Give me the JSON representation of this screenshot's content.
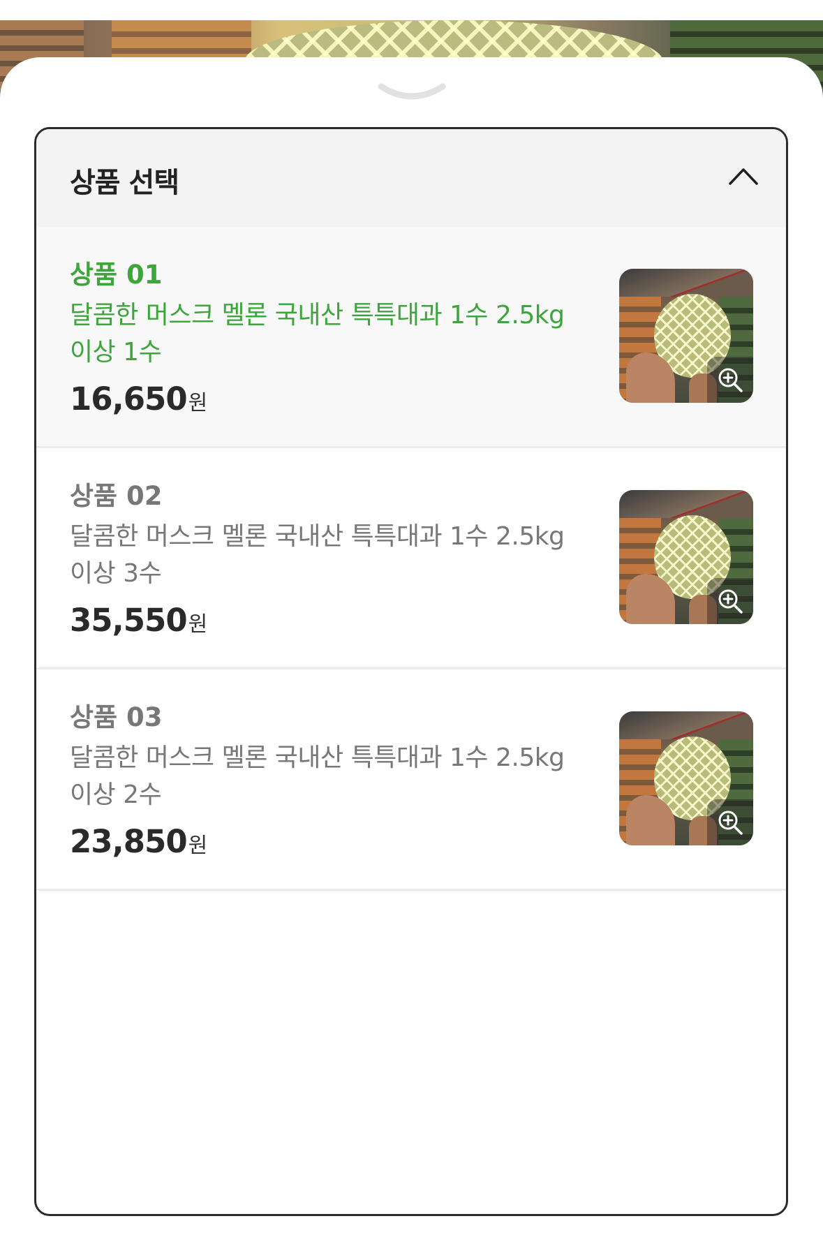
{
  "section": {
    "title": "상품 선택"
  },
  "products": [
    {
      "label": "상품 01",
      "name": "달콤한 머스크 멜론 국내산 특특대과 1수 2.5kg 이상 1수",
      "price": "16,650",
      "currency": "원",
      "selected": true
    },
    {
      "label": "상품 02",
      "name": "달콤한 머스크 멜론 국내산 특특대과 1수 2.5kg 이상 3수",
      "price": "35,550",
      "currency": "원",
      "selected": false
    },
    {
      "label": "상품 03",
      "name": "달콤한 머스크 멜론 국내산 특특대과 1수 2.5kg 이상 2수",
      "price": "23,850",
      "currency": "원",
      "selected": false
    }
  ],
  "colors": {
    "accent": "#3da53b",
    "text_dark": "#222222",
    "text_muted": "#777777",
    "border": "#2b2b2b",
    "header_bg": "#f3f3f3"
  },
  "icons": {
    "grabber": "chevron-down-icon",
    "collapse": "chevron-up-icon",
    "zoom": "zoom-in-icon"
  }
}
